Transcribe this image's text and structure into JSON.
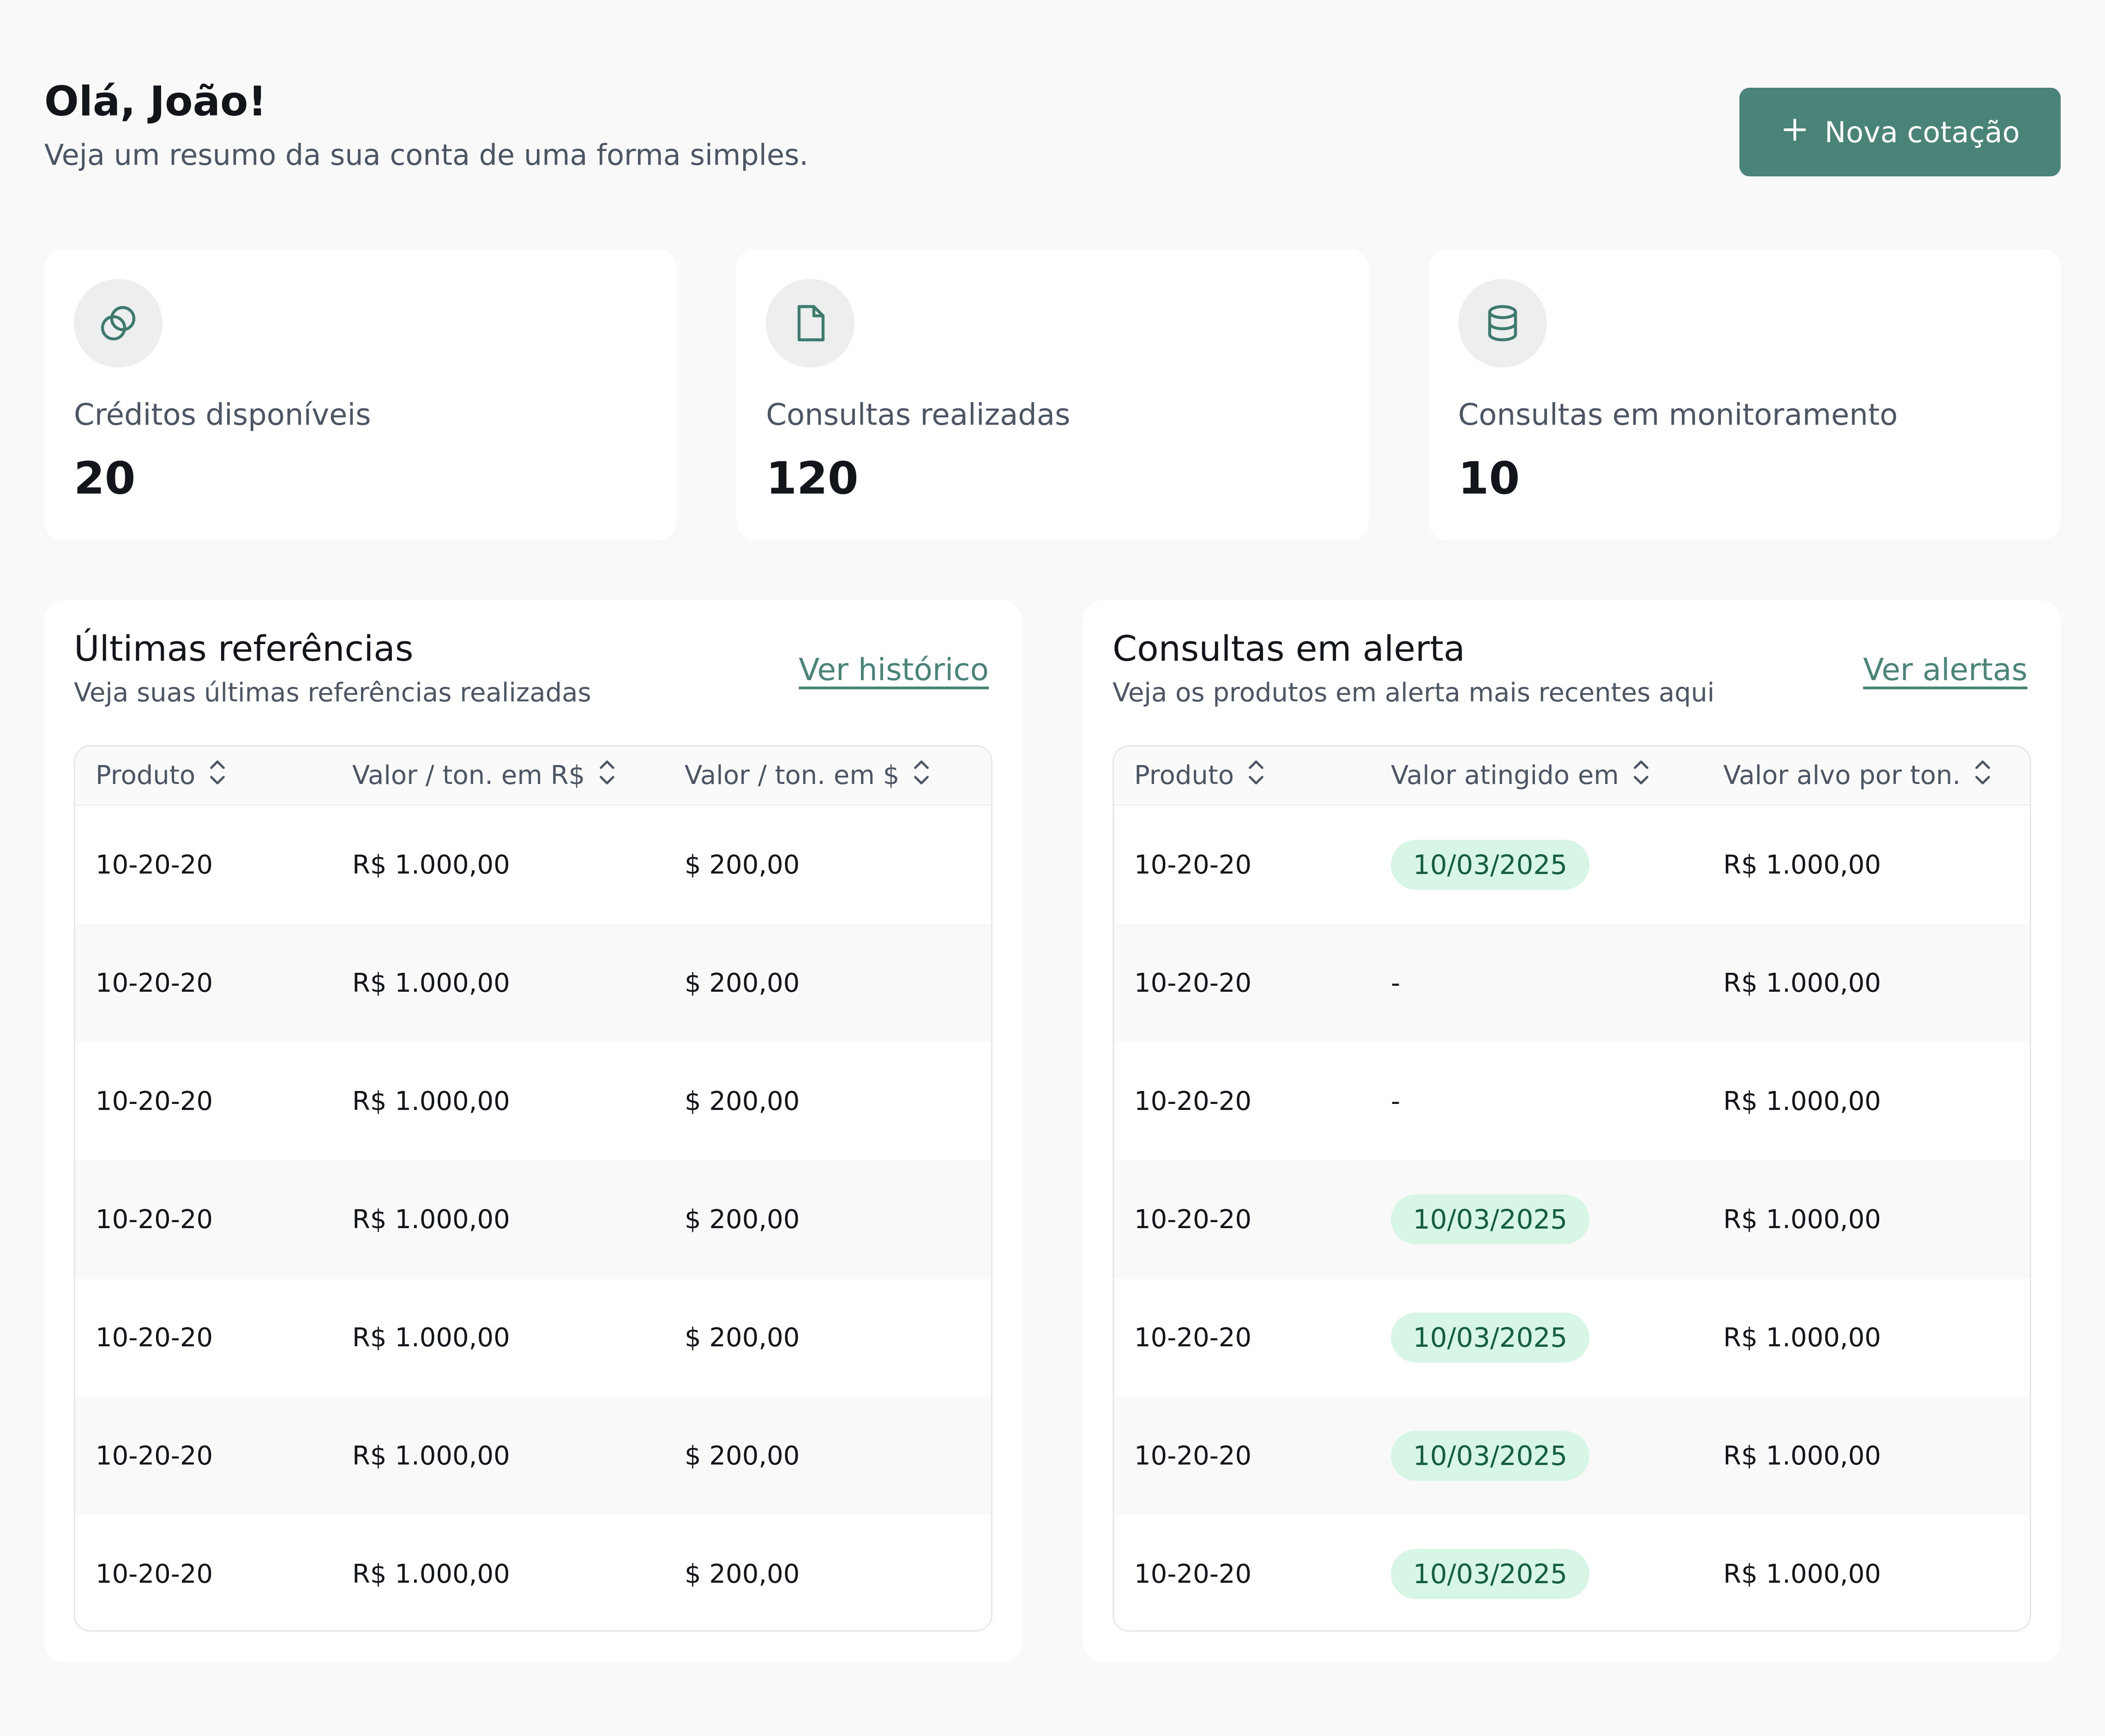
{
  "header": {
    "greeting": "Olá, João!",
    "subtitle": "Veja um resumo da sua conta de uma forma simples.",
    "new_button_label": "Nova cotação",
    "new_button_icon": "plus-icon"
  },
  "stats": [
    {
      "icon": "coins-icon",
      "label": "Créditos disponíveis",
      "value": "20"
    },
    {
      "icon": "file-icon",
      "label": "Consultas realizadas",
      "value": "120"
    },
    {
      "icon": "database-icon",
      "label": "Consultas em monitoramento",
      "value": "10"
    }
  ],
  "references": {
    "title": "Últimas referências",
    "subtitle": "Veja suas últimas referências realizadas",
    "link": "Ver histórico",
    "columns": [
      "Produto",
      "Valor / ton. em R$",
      "Valor / ton. em $"
    ],
    "rows": [
      [
        "10-20-20",
        "R$ 1.000,00",
        "$ 200,00"
      ],
      [
        "10-20-20",
        "R$ 1.000,00",
        "$ 200,00"
      ],
      [
        "10-20-20",
        "R$ 1.000,00",
        "$ 200,00"
      ],
      [
        "10-20-20",
        "R$ 1.000,00",
        "$ 200,00"
      ],
      [
        "10-20-20",
        "R$ 1.000,00",
        "$ 200,00"
      ],
      [
        "10-20-20",
        "R$ 1.000,00",
        "$ 200,00"
      ],
      [
        "10-20-20",
        "R$ 1.000,00",
        "$ 200,00"
      ]
    ]
  },
  "alerts": {
    "title": "Consultas em alerta",
    "subtitle": "Veja os produtos em alerta mais recentes aqui",
    "link": "Ver alertas",
    "columns": [
      "Produto",
      "Valor atingido em",
      "Valor alvo por ton."
    ],
    "rows": [
      [
        "10-20-20",
        "10/03/2025",
        "R$ 1.000,00"
      ],
      [
        "10-20-20",
        "-",
        "R$ 1.000,00"
      ],
      [
        "10-20-20",
        "-",
        "R$ 1.000,00"
      ],
      [
        "10-20-20",
        "10/03/2025",
        "R$ 1.000,00"
      ],
      [
        "10-20-20",
        "10/03/2025",
        "R$ 1.000,00"
      ],
      [
        "10-20-20",
        "10/03/2025",
        "R$ 1.000,00"
      ],
      [
        "10-20-20",
        "10/03/2025",
        "R$ 1.000,00"
      ]
    ]
  },
  "colors": {
    "accent": "#4a8479",
    "badge_bg": "#d8f6e6",
    "badge_text": "#155e40",
    "background": "#f9f9f9"
  }
}
